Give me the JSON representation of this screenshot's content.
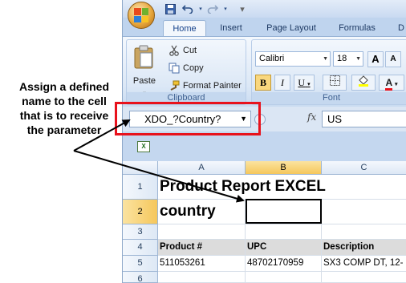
{
  "annotation": {
    "text": "Assign a defined name to the cell that is to receive the parameter"
  },
  "quick_access": {
    "save_icon": "save-icon",
    "undo_icon": "undo-icon",
    "redo_icon": "redo-icon"
  },
  "tabs": [
    {
      "label": "Home",
      "active": true
    },
    {
      "label": "Insert"
    },
    {
      "label": "Page Layout"
    },
    {
      "label": "Formulas"
    },
    {
      "label": "D"
    }
  ],
  "clipboard": {
    "paste_label": "Paste",
    "cut_label": "Cut",
    "copy_label": "Copy",
    "format_painter_label": "Format Painter",
    "group_label": "Clipboard"
  },
  "font": {
    "family": "Calibri",
    "size": "18",
    "bold": "B",
    "italic": "I",
    "underline": "U",
    "grow": "A",
    "shrink": "A",
    "font_color": "A",
    "group_label": "Font"
  },
  "formula_bar": {
    "name_box": "XDO_?Country?",
    "fx_label": "fx",
    "value": "US"
  },
  "grid": {
    "columns": [
      "A",
      "B",
      "C"
    ],
    "selected_column": "B",
    "rows": [
      {
        "num": "1",
        "a": "Product Report EXCEL",
        "b": "",
        "c": ""
      },
      {
        "num": "2",
        "a": "country",
        "b": "",
        "c": ""
      },
      {
        "num": "3",
        "a": "",
        "b": "",
        "c": ""
      },
      {
        "num": "4",
        "a": "Product #",
        "b": "UPC",
        "c": "Description"
      },
      {
        "num": "5",
        "a": "511053261",
        "b": "48702170959",
        "c": "SX3 COMP DT, 12-"
      },
      {
        "num": "6",
        "a": "",
        "b": "",
        "c": ""
      }
    ],
    "selected_row": "2",
    "active_cell": "B2"
  },
  "colors": {
    "highlight_border": "#e8121c",
    "ribbon": "#dce8f6",
    "selected_header": "#f5c75c"
  }
}
